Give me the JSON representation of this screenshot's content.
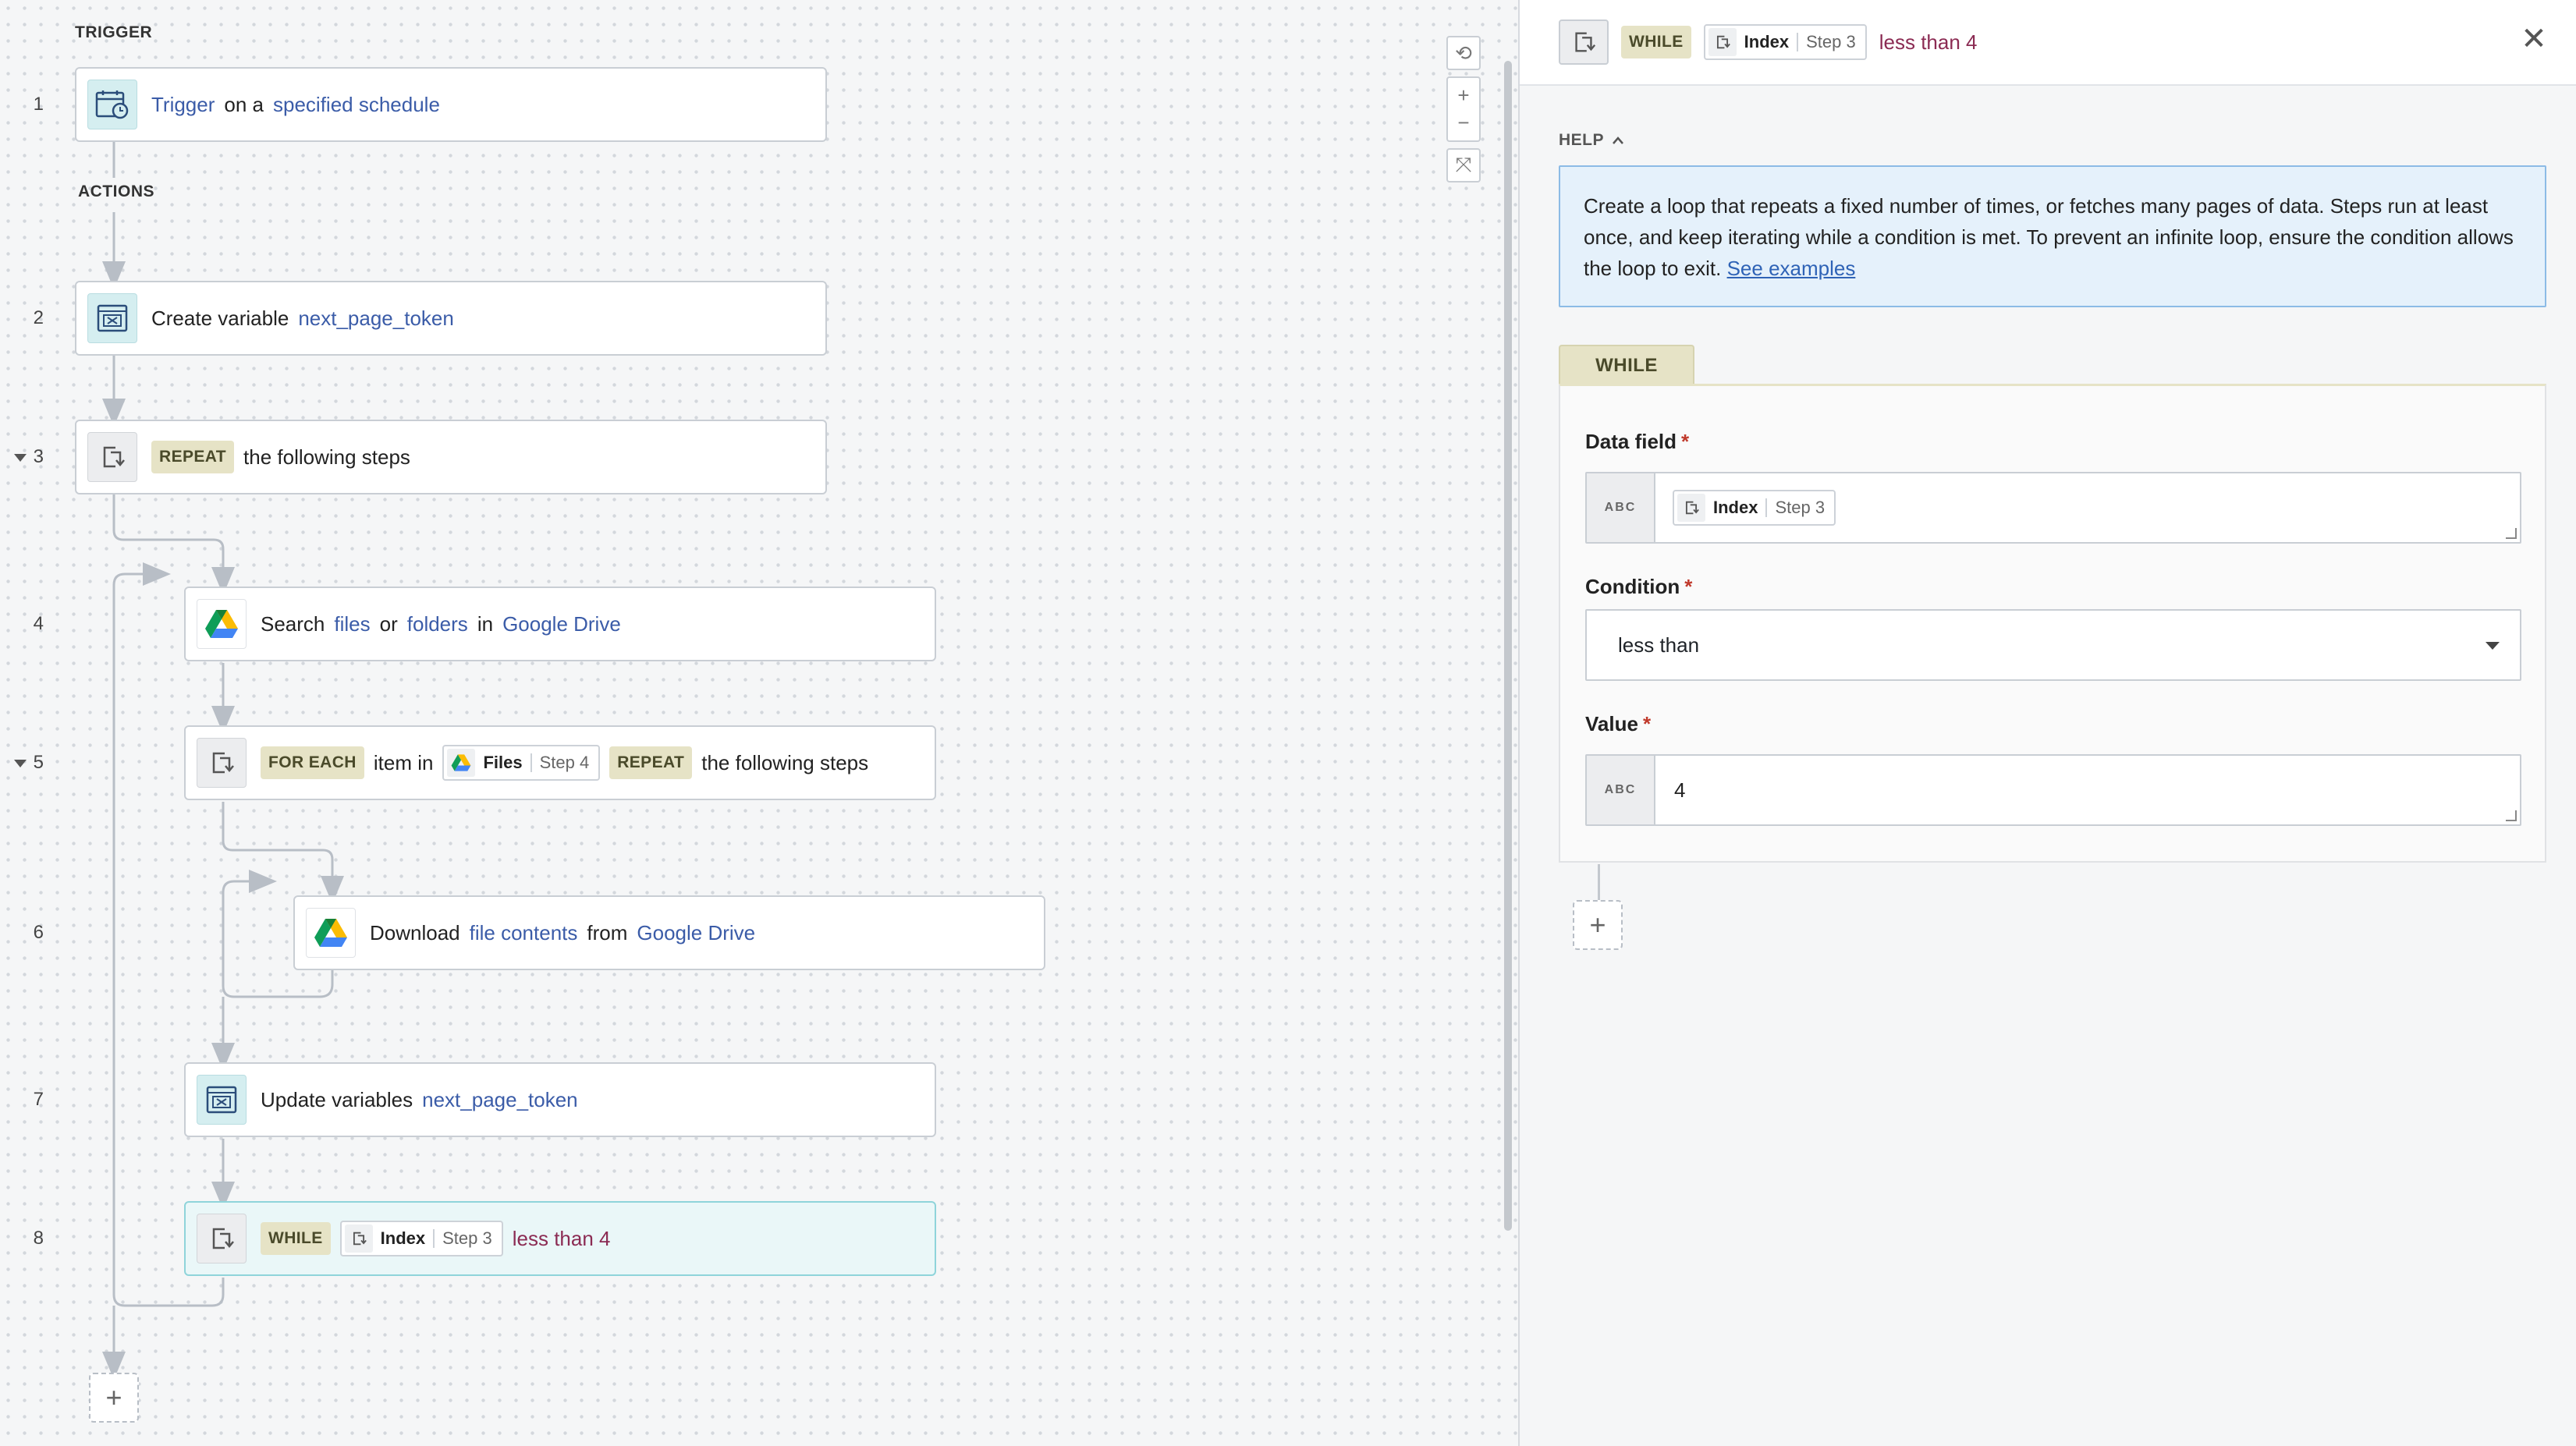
{
  "canvas": {
    "trigger_label": "TRIGGER",
    "actions_label": "ACTIONS",
    "steps": [
      {
        "num": "1",
        "parts": [
          "Trigger",
          "on a",
          "specified schedule"
        ]
      },
      {
        "num": "2",
        "parts": [
          "Create variable",
          "next_page_token"
        ]
      },
      {
        "num": "3",
        "badge": "REPEAT",
        "text": "the following steps"
      },
      {
        "num": "4",
        "parts": [
          "Search",
          "files",
          "or",
          "folders",
          "in",
          "Google Drive"
        ]
      },
      {
        "num": "5",
        "badge": "FOR EACH",
        "item_in": "item in",
        "pill_name": "Files",
        "pill_step": "Step 4",
        "badge2": "REPEAT",
        "text": "the following steps"
      },
      {
        "num": "6",
        "parts": [
          "Download",
          "file contents",
          "from",
          "Google Drive"
        ]
      },
      {
        "num": "7",
        "parts": [
          "Update variables",
          "next_page_token"
        ]
      },
      {
        "num": "8",
        "badge": "WHILE",
        "pill_name": "Index",
        "pill_step": "Step 3",
        "condition": "less than 4"
      }
    ],
    "add_label": "+",
    "zoom": {
      "reset": "⟲",
      "in": "+",
      "out": "−",
      "fit": "⤧"
    }
  },
  "panel": {
    "header": {
      "badge": "WHILE",
      "pill_name": "Index",
      "pill_step": "Step 3",
      "condition": "less than 4",
      "close": "✕"
    },
    "help_label": "HELP",
    "help_text": "Create a loop that repeats a fixed number of times, or fetches many pages of data. Steps run at least once, and keep iterating while a condition is met. To prevent an infinite loop, ensure the condition allows the loop to exit.",
    "help_link": "See examples",
    "tab": "WHILE",
    "fields": {
      "data_field_label": "Data field",
      "data_field_pill_name": "Index",
      "data_field_pill_step": "Step 3",
      "condition_label": "Condition",
      "condition_value": "less than",
      "value_label": "Value",
      "value_value": "4",
      "abc": "ABC",
      "required": "*"
    },
    "add_label": "+"
  },
  "colors": {
    "link": "#3b5ca8",
    "badge_bg": "#e6e3c6",
    "condition": "#8b2b53",
    "selected_bg": "#eaf7f8",
    "help_bg": "#e5f1fb"
  }
}
